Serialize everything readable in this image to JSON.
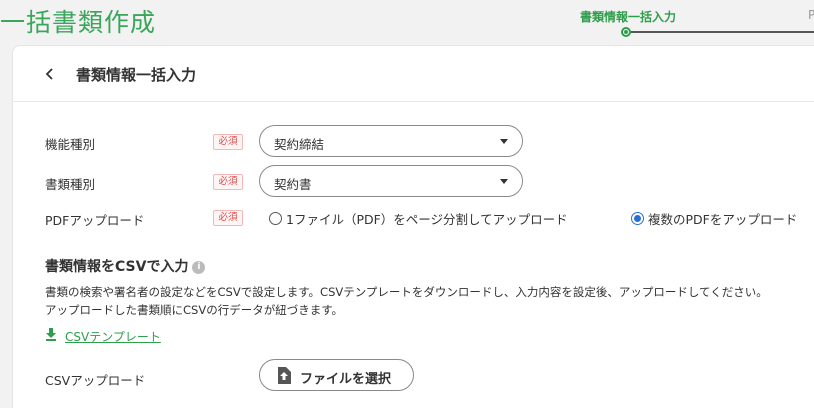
{
  "page": {
    "title": "一括書類作成"
  },
  "stepper": {
    "current_label": "書類情報一括入力",
    "next_label": "P"
  },
  "header": {
    "title": "書類情報一括入力"
  },
  "form": {
    "required_label": "必須",
    "function_type": {
      "label": "機能種別",
      "value": "契約締結"
    },
    "document_type": {
      "label": "書類種別",
      "value": "契約書"
    },
    "pdf_upload": {
      "label": "PDFアップロード",
      "options": [
        {
          "label": "1ファイル（PDF）をページ分割してアップロード",
          "selected": false
        },
        {
          "label": "複数のPDFをアップロード",
          "selected": true
        }
      ]
    }
  },
  "csv_section": {
    "title": "書類情報をCSVで入力",
    "description_line1": "書類の検索や署名者の設定などをCSVで設定します。CSVテンプレートをダウンロードし、入力内容を設定後、アップロードしてください。",
    "description_line2": "アップロードした書類順にCSVの行データが紐づきます。",
    "template_link": "CSVテンプレート",
    "upload_label": "CSVアップロード",
    "file_button": "ファイルを選択"
  },
  "colors": {
    "accent": "#2f9e4c",
    "required": "#e04848",
    "radio": "#2a6fd6"
  }
}
